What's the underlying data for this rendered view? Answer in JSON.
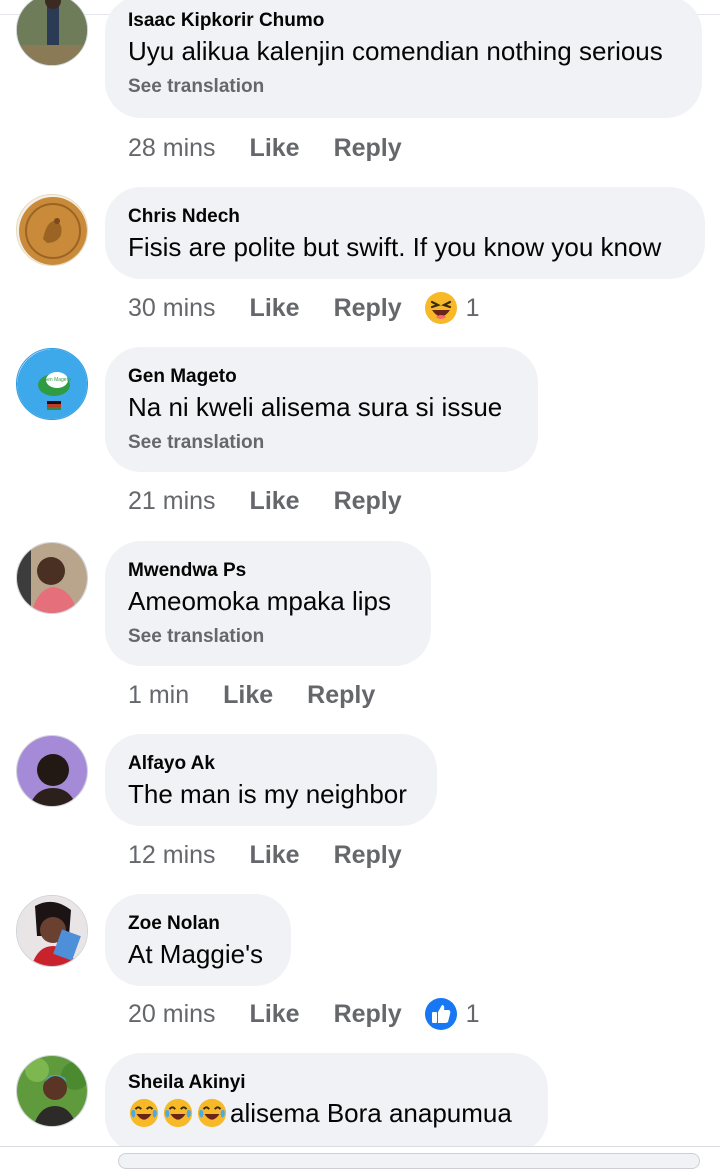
{
  "comments": [
    {
      "author": "Isaac Kipkorir Chumo",
      "text": "Uyu alikua kalenjin comendian nothing serious",
      "see_translation": "See translation",
      "time": "28 mins",
      "like": "Like",
      "reply": "Reply"
    },
    {
      "author": "Chris Ndech",
      "text": "Fisis are polite but swift. If you know you know",
      "time": "30 mins",
      "like": "Like",
      "reply": "Reply",
      "reaction": {
        "icon": "laughing-squint-emoji-icon",
        "count": "1"
      }
    },
    {
      "author": "Gen Mageto",
      "text": "Na ni kweli alisema sura si issue",
      "see_translation": "See translation",
      "time": "21 mins",
      "like": "Like",
      "reply": "Reply",
      "avatar_text": "Gen Mageto"
    },
    {
      "author": "Mwendwa Ps",
      "text": "Ameomoka mpaka lips",
      "see_translation": "See translation",
      "time": "1 min",
      "like": "Like",
      "reply": "Reply"
    },
    {
      "author": "Alfayo Ak",
      "text": "The man is my neighbor",
      "time": "12 mins",
      "like": "Like",
      "reply": "Reply"
    },
    {
      "author": "Zoe Nolan",
      "text": "At Maggie's",
      "time": "20 mins",
      "like": "Like",
      "reply": "Reply",
      "reaction": {
        "icon": "thumbs-up-reaction-icon",
        "count": "1"
      }
    },
    {
      "author": "Sheila Akinyi",
      "text": "alisema Bora anapumua"
    }
  ],
  "colors": {
    "bubble": "#f0f2f5",
    "secondary_text": "#65676b",
    "like_blue": "#1877f2"
  }
}
